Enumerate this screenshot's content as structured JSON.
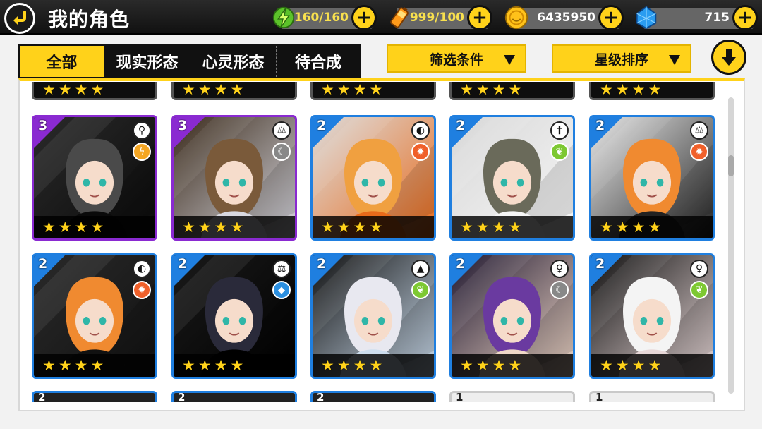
{
  "header": {
    "title": "我的角色",
    "stamina": "160/160",
    "energy": "999/100",
    "gold": "6435950",
    "gems": "715"
  },
  "tabs": [
    {
      "label": "全部",
      "active": true
    },
    {
      "label": "现实形态",
      "active": false
    },
    {
      "label": "心灵形态",
      "active": false
    },
    {
      "label": "待合成",
      "active": false
    }
  ],
  "filters": {
    "filter_label": "筛选条件",
    "sort_label": "星级排序"
  },
  "colors": {
    "accent": "#ffd21a",
    "blue_frame": "#1f7fe0",
    "purple_frame": "#8a2ad1",
    "fire": "#f0602a",
    "nature": "#7dc832",
    "water": "#2b8fe0",
    "dark": "#888888",
    "light": "#f5a623"
  },
  "characters_row1": [
    {
      "rank": "3",
      "frame": "purple",
      "class_icon": "female-symbol-icon",
      "element": "light",
      "stars": 4
    },
    {
      "rank": "3",
      "frame": "purple",
      "class_icon": "balance-scale-icon",
      "element": "dark",
      "stars": 4
    },
    {
      "rank": "2",
      "frame": "blue",
      "class_icon": "shield-icon",
      "element": "fire",
      "stars": 4
    },
    {
      "rank": "2",
      "frame": "blue",
      "class_icon": "sword-icon",
      "element": "nature",
      "stars": 4
    },
    {
      "rank": "2",
      "frame": "blue",
      "class_icon": "balance-scale-icon",
      "element": "fire",
      "stars": 4
    }
  ],
  "characters_row2": [
    {
      "rank": "2",
      "frame": "blue",
      "class_icon": "shield-icon",
      "element": "fire",
      "stars": 4
    },
    {
      "rank": "2",
      "frame": "blue",
      "class_icon": "balance-scale-icon",
      "element": "water",
      "stars": 4
    },
    {
      "rank": "2",
      "frame": "blue",
      "class_icon": "triforce-icon",
      "element": "nature",
      "stars": 4
    },
    {
      "rank": "2",
      "frame": "blue",
      "class_icon": "female-symbol-icon",
      "element": "dark",
      "stars": 4
    },
    {
      "rank": "2",
      "frame": "blue",
      "class_icon": "female-symbol-icon",
      "element": "nature",
      "stars": 4
    }
  ],
  "row3_partial": [
    {
      "rank": "2",
      "frame": "blue"
    },
    {
      "rank": "2",
      "frame": "blue"
    },
    {
      "rank": "2",
      "frame": "blue"
    },
    {
      "rank": "1",
      "frame": "grey"
    },
    {
      "rank": "1",
      "frame": "grey"
    }
  ]
}
